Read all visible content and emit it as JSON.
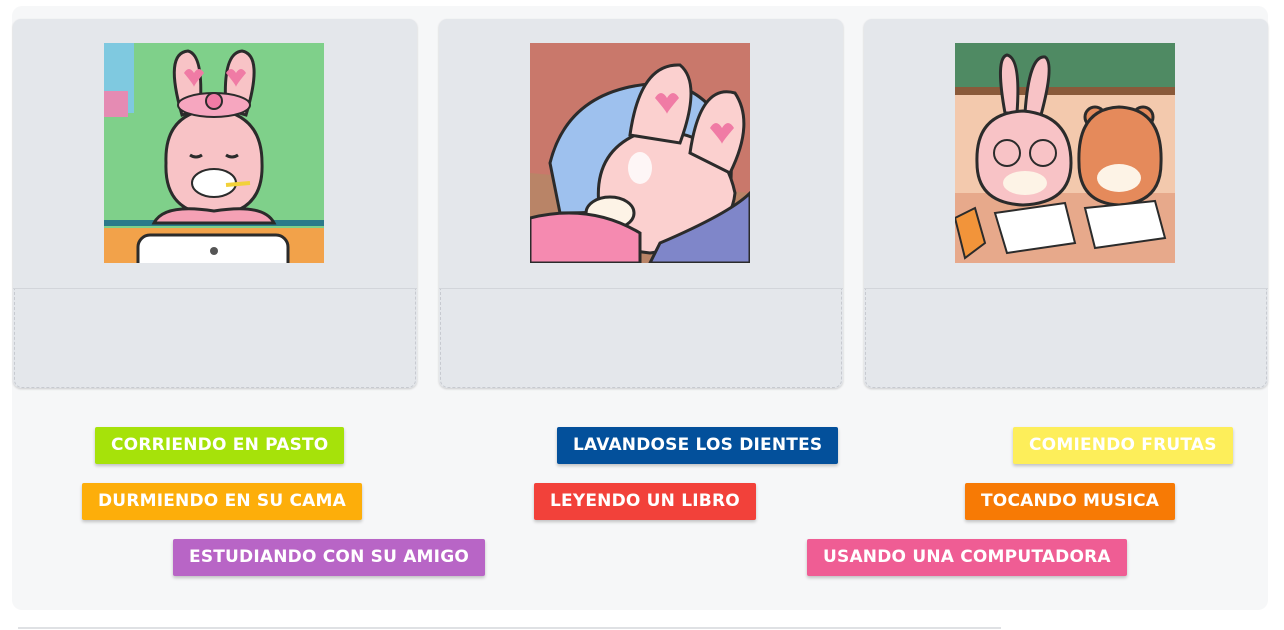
{
  "cards": [
    {
      "image": "bunny-brushing-teeth-illustration",
      "drop_value": ""
    },
    {
      "image": "bunny-sleeping-in-bed-illustration",
      "drop_value": ""
    },
    {
      "image": "bunny-studying-with-friend-illustration",
      "drop_value": ""
    }
  ],
  "options": [
    {
      "label": "CORRIENDO EN PASTO",
      "color": "#a6e20a"
    },
    {
      "label": "LAVANDOSE LOS DIENTES",
      "color": "#03509b"
    },
    {
      "label": "COMIENDO FRUTAS",
      "color": "#fdee5a"
    },
    {
      "label": "DURMIENDO EN SU CAMA",
      "color": "#fdae0a"
    },
    {
      "label": "LEYENDO UN LIBRO",
      "color": "#f2413a"
    },
    {
      "label": "TOCANDO MUSICA",
      "color": "#f77a05"
    },
    {
      "label": "ESTUDIANDO CON SU AMIGO",
      "color": "#b865c6"
    },
    {
      "label": "USANDO UNA COMPUTADORA",
      "color": "#ef5d94"
    }
  ]
}
